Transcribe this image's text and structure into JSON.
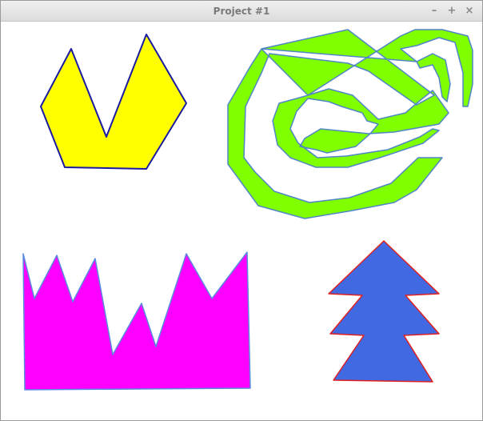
{
  "window": {
    "title": "Project #1",
    "controls": {
      "minimize": "–",
      "maximize": "+",
      "close": "×"
    }
  },
  "shapes": [
    {
      "name": "yellow-crown-polygon",
      "fill": "#ffff00",
      "stroke": "#1a1aa0"
    },
    {
      "name": "green-spiral-polygon",
      "fill": "#80ff00",
      "stroke": "#4f86c6"
    },
    {
      "name": "magenta-zigzag-polygon",
      "fill": "#ff00ff",
      "stroke": "#5a8adf"
    },
    {
      "name": "blue-tree-polygon",
      "fill": "#4169e1",
      "stroke": "#e02020"
    }
  ]
}
